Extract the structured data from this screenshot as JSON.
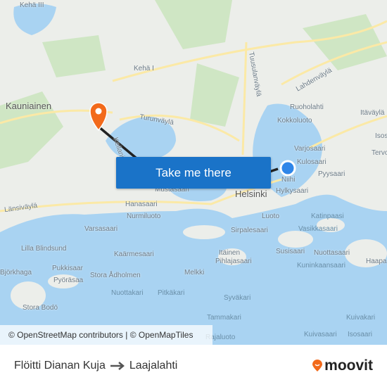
{
  "map": {
    "labels": [
      "Kehä III",
      "Kehä I",
      "Kauniainen",
      "Turunväylä",
      "Tuusulanväylä",
      "Lahdenväylä",
      "Ruoholahti",
      "Kokkoluoto",
      "Itäväylä",
      "Varjosaari",
      "Kulosaari",
      "Pyysaari",
      "Tervo",
      "Isos",
      "Länsiväylä",
      "Hanasaari",
      "Nurmiluoto",
      "Mustasaari",
      "Helsinki",
      "Niihi",
      "Hylkysaari",
      "Luoto",
      "Katinpaasi",
      "Vasikkasaari",
      "Lilla Blindsund",
      "Kaärmesaari",
      "Itäinen Pihlajasaari",
      "Susisaari",
      "Nuottasaari",
      "Kuninkaansaari",
      "Haapa",
      "Pukkisaar",
      "Pyöräsaa",
      "Stora Ådholmen",
      "Melkki",
      "Nuottakari",
      "Pitkäkari",
      "Stora Bodö",
      "Syväkari",
      "Tammakari",
      "Kuivakari",
      "Kuivasaari",
      "Isosaari",
      "Rajaluoto",
      "Björkhaga",
      "Varsasaari",
      "Sirpalesaari",
      "Keilaniemi"
    ],
    "cta_label": "Take me there",
    "attribution": "© OpenStreetMap contributors | © OpenMapTiles",
    "colors": {
      "water": "#a9d3f2",
      "land": "#eceeea",
      "green": "#cfe6c4",
      "road": "#fbe9a6",
      "route": "#222222",
      "origin": "#2f86e8",
      "destination": "#f26a1b",
      "button": "#1a73c8"
    }
  },
  "footer": {
    "origin": "Flöitti Dianan Kuja",
    "destination": "Laajalahti",
    "brand": "moovit"
  }
}
